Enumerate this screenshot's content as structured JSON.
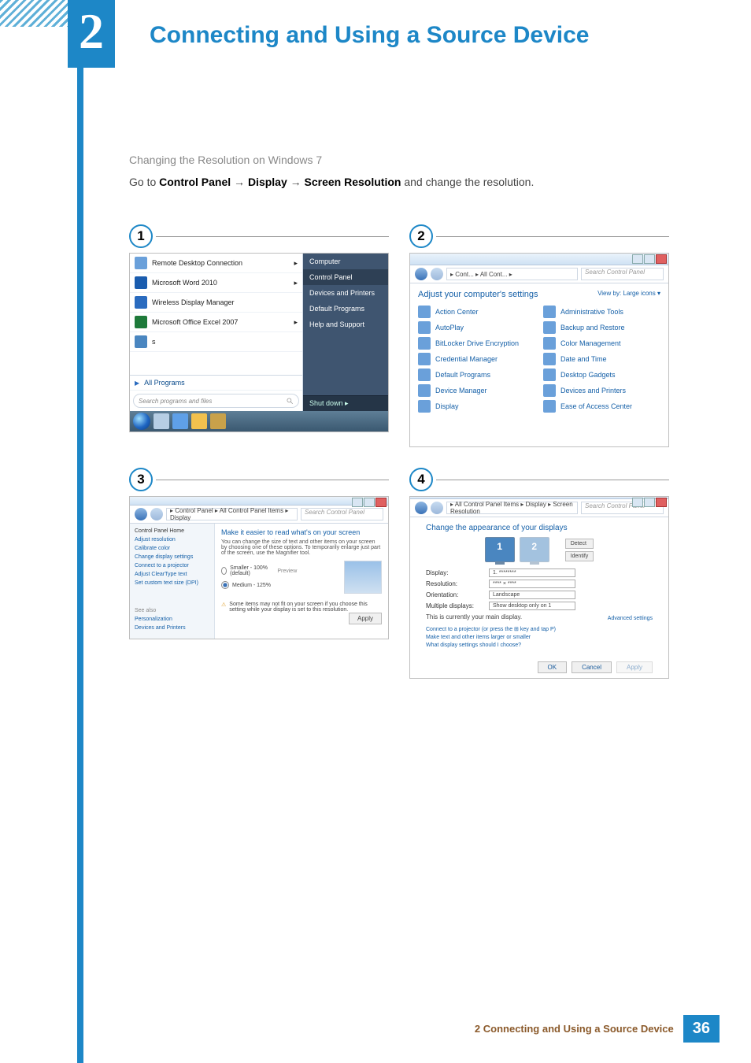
{
  "chapter_number": "2",
  "chapter_title": "Connecting and Using a Source Device",
  "subheading": "Changing the Resolution on Windows 7",
  "instruction": {
    "prefix": "Go to ",
    "path1": "Control Panel",
    "arrow": " → ",
    "path2": "Display",
    "path3": "Screen Resolution",
    "suffix": " and change the resolution."
  },
  "screenshots": {
    "s1": {
      "badge": "1",
      "left_items": [
        "Remote Desktop Connection",
        "Microsoft Word 2010",
        "Wireless Display Manager",
        "Microsoft Office Excel 2007",
        "s"
      ],
      "all_programs": "All Programs",
      "search_placeholder": "Search programs and files",
      "right_items": [
        "Computer",
        "Control Panel",
        "Devices and Printers",
        "Default Programs",
        "Help and Support"
      ],
      "shutdown": "Shut down"
    },
    "s2": {
      "badge": "2",
      "breadcrumb": "▸ Cont... ▸ All Cont... ▸",
      "search_placeholder": "Search Control Panel",
      "heading": "Adjust your computer's settings",
      "viewby": "View by:  Large icons ▾",
      "items": [
        "Action Center",
        "Administrative Tools",
        "AutoPlay",
        "Backup and Restore",
        "BitLocker Drive Encryption",
        "Color Management",
        "Credential Manager",
        "Date and Time",
        "Default Programs",
        "Desktop Gadgets",
        "Device Manager",
        "Devices and Printers",
        "Display",
        "Ease of Access Center"
      ]
    },
    "s3": {
      "badge": "3",
      "breadcrumb": "▸ Control Panel ▸ All Control Panel Items ▸ Display",
      "search_placeholder": "Search Control Panel",
      "side_title": "Control Panel Home",
      "side_links": [
        "Adjust resolution",
        "Calibrate color",
        "Change display settings",
        "Connect to a projector",
        "Adjust ClearType text",
        "Set custom text size (DPI)"
      ],
      "see_also": "See also",
      "see_links": [
        "Personalization",
        "Devices and Printers"
      ],
      "main_title": "Make it easier to read what's on your screen",
      "main_desc": "You can change the size of text and other items on your screen by choosing one of these options. To temporarily enlarge just part of the screen, use the Magnifier tool.",
      "radio1": "Smaller - 100% (default)",
      "preview": "Preview",
      "radio2": "Medium - 125%",
      "warn": "Some items may not fit on your screen if you choose this setting while your display is set to this resolution.",
      "apply": "Apply"
    },
    "s4": {
      "badge": "4",
      "breadcrumb": "▸ All Control Panel Items ▸ Display ▸ Screen Resolution",
      "search_placeholder": "Search Control Panel",
      "main_title": "Change the appearance of your displays",
      "detect": "Detect",
      "identify": "Identify",
      "mon1": "1",
      "mon2": "2",
      "fields": {
        "display_l": "Display:",
        "display_v": "1. ********",
        "res_l": "Resolution:",
        "res_v": "**** × ****",
        "orient_l": "Orientation:",
        "orient_v": "Landscape",
        "multi_l": "Multiple displays:",
        "multi_v": "Show desktop only on 1"
      },
      "main_note": "This is currently your main display.",
      "adv": "Advanced settings",
      "link1": "Connect to a projector (or press the ⊞ key and tap P)",
      "link2": "Make text and other items larger or smaller",
      "link3": "What display settings should I choose?",
      "ok": "OK",
      "cancel": "Cancel",
      "apply": "Apply"
    }
  },
  "footer": {
    "text": "2 Connecting and Using a Source Device",
    "page": "36"
  }
}
